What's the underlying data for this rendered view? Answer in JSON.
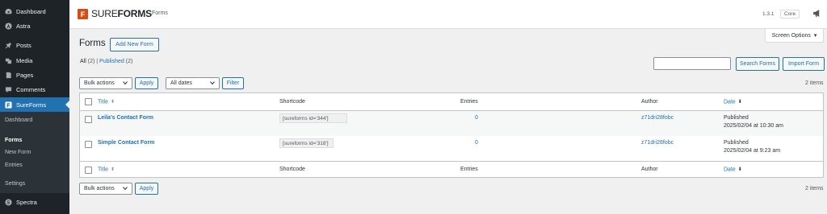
{
  "sidebar": {
    "items": [
      {
        "label": "Dashboard",
        "icon": "dashboard-icon"
      },
      {
        "label": "Astra",
        "icon": "astra-icon"
      },
      {
        "label": "Posts",
        "icon": "pin-icon"
      },
      {
        "label": "Media",
        "icon": "media-icon"
      },
      {
        "label": "Pages",
        "icon": "pages-icon"
      },
      {
        "label": "Comments",
        "icon": "comments-icon"
      },
      {
        "label": "SureForms",
        "icon": "sureforms-icon"
      }
    ],
    "submenu": [
      "Dashboard",
      "Forms",
      "New Form",
      "Entries",
      "Settings"
    ],
    "spectra": {
      "label": "Spectra",
      "icon": "spectra-icon"
    },
    "active_color": "#2271b1"
  },
  "topbar": {
    "logo_sure": "SURE",
    "logo_forms": "FORMS",
    "logo_box": "F",
    "breadcrumb_sep": "›",
    "breadcrumb": "Forms",
    "version": "1.3.1",
    "badge": "Core",
    "brand_color": "#d54d12"
  },
  "screen_options": {
    "label": "Screen Options",
    "arrow": "▾"
  },
  "page": {
    "title": "Forms",
    "add_new": "Add New Form",
    "filter_all": "All",
    "filter_all_count": "(2)",
    "filter_sep": "|",
    "filter_published": "Published",
    "filter_published_count": "(2)",
    "search_button": "Search Forms",
    "import_button": "Import Form",
    "bulk_actions": "Bulk actions",
    "apply": "Apply",
    "all_dates": "All dates",
    "filter": "Filter",
    "items_count": "2 items"
  },
  "table": {
    "columns": {
      "title": "Title",
      "shortcode": "Shortcode",
      "entries": "Entries",
      "author": "Author",
      "date": "Date"
    },
    "rows": [
      {
        "title": "Leila's Contact Form",
        "shortcode": "[sureforms id='344']",
        "entries": "0",
        "author": "z71dri28fobc",
        "status": "Published",
        "date": "2025/02/04 at 10:30 am"
      },
      {
        "title": "Simple Contact Form",
        "shortcode": "[sureforms id='318']",
        "entries": "0",
        "author": "z71dri28fobc",
        "status": "Published",
        "date": "2025/02/04 at 9:23 am"
      }
    ]
  }
}
